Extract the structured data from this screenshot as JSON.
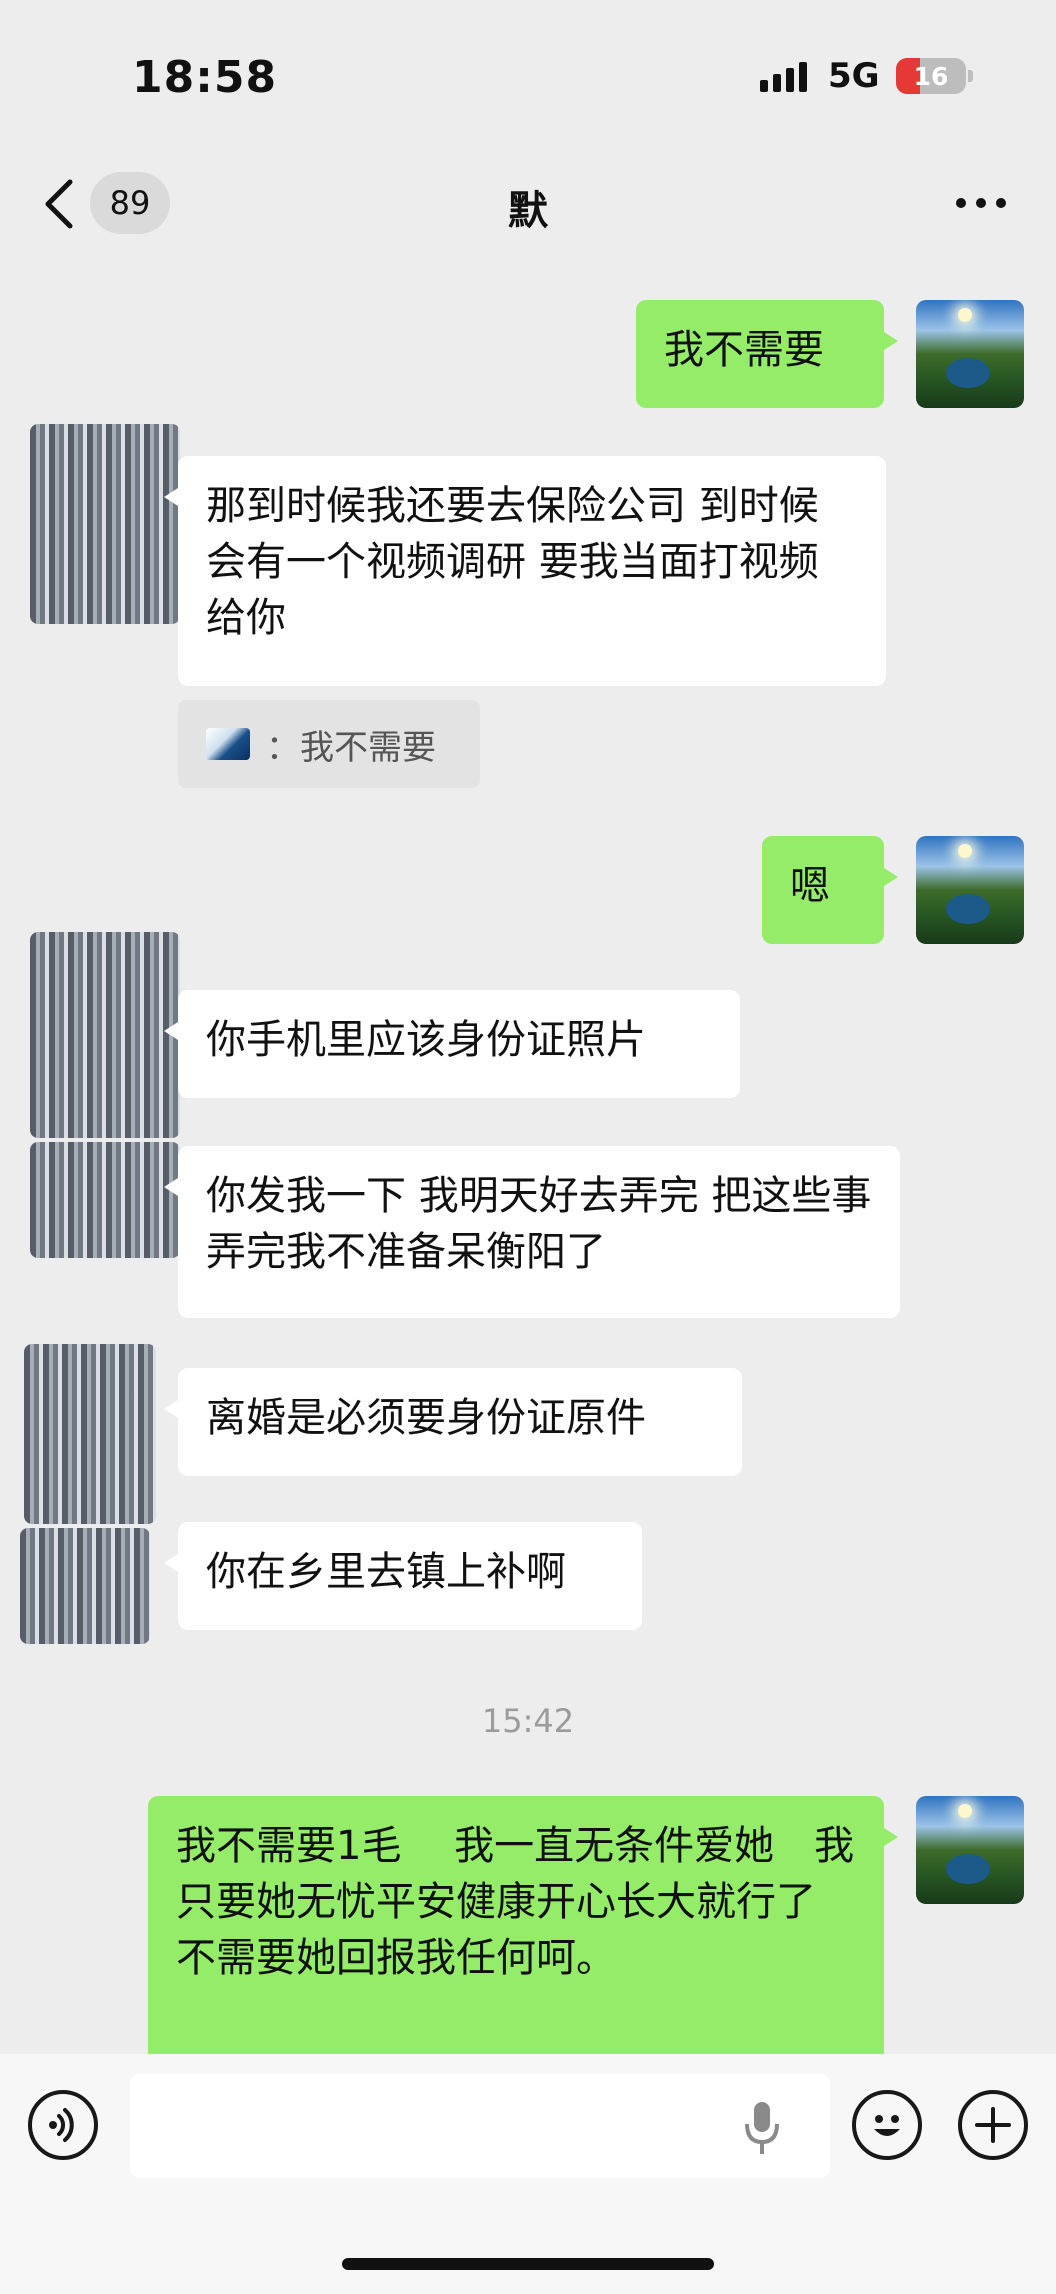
{
  "status_bar": {
    "time": "18:58",
    "network": "5G",
    "battery": "16"
  },
  "header": {
    "unread_count": "89",
    "title": "默"
  },
  "messages": [
    {
      "from": "me",
      "text": "我不需要"
    },
    {
      "from": "other",
      "text": "那到时候我还要去保险公司 到时候会有一个视频调研 要我当面打视频给你"
    },
    {
      "from": "quote",
      "text": "：我不需要"
    },
    {
      "from": "me",
      "text": "嗯"
    },
    {
      "from": "other",
      "text": "你手机里应该身份证照片"
    },
    {
      "from": "other",
      "text": "你发我一下 我明天好去弄完 把这些事弄完我不准备呆衡阳了"
    },
    {
      "from": "other",
      "text": "离婚是必须要身份证原件"
    },
    {
      "from": "other",
      "text": "你在乡里去镇上补啊"
    },
    {
      "from": "time",
      "text": "15:42"
    },
    {
      "from": "me",
      "text": " 我不需要1毛　 我一直无条件爱她　我只要她无忧平安健康开心长大就行了　不需要她回报我任何呵。"
    }
  ],
  "colors": {
    "me_bubble": "#95ec69",
    "other_bubble": "#ffffff",
    "background": "#ededed"
  },
  "icons": [
    "chevron-left-icon",
    "more-icon",
    "voice-icon",
    "mic-icon",
    "emoji-icon",
    "plus-icon"
  ]
}
